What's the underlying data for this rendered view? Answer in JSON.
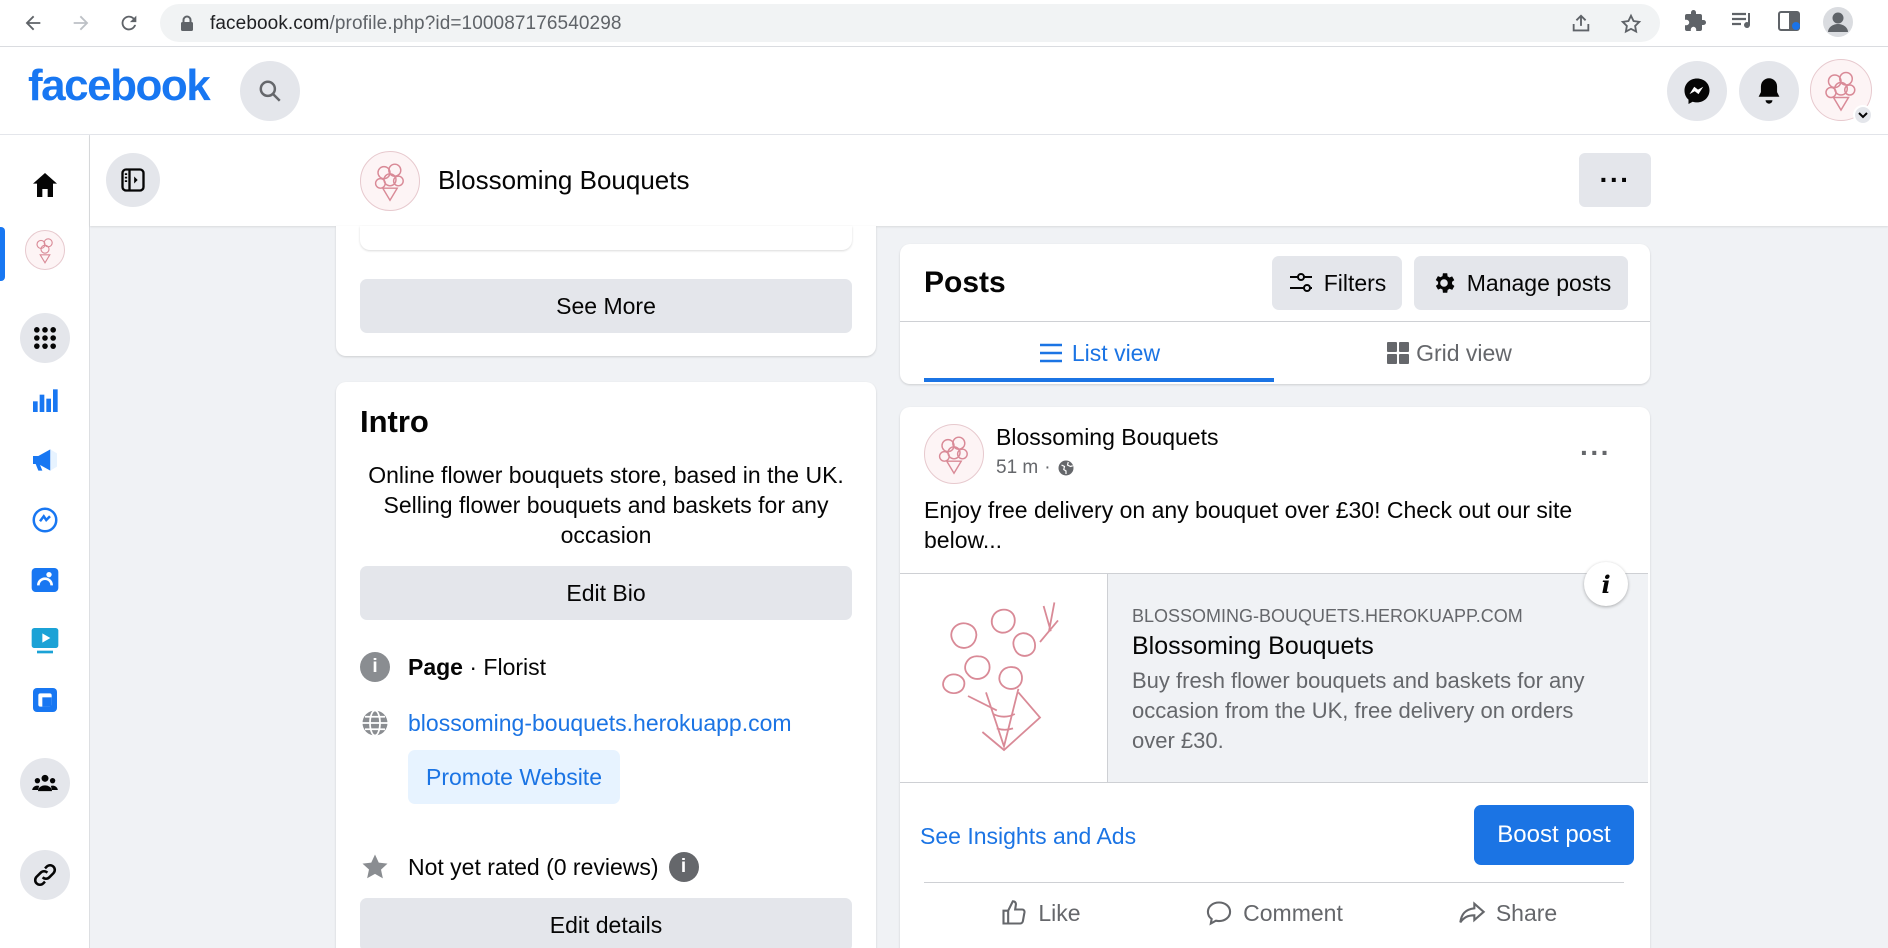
{
  "browser": {
    "url_host": "facebook.com",
    "url_path": "/profile.php?id=100087176540298"
  },
  "header": {
    "logo_text": "facebook"
  },
  "page": {
    "name": "Blossoming Bouquets"
  },
  "left_card": {
    "see_more_label": "See More"
  },
  "intro": {
    "title": "Intro",
    "bio": "Online flower bouquets store, based in the UK. Selling flower bouquets and baskets for any occasion",
    "edit_bio_label": "Edit Bio",
    "page_label": "Page",
    "category": " · Florist",
    "website": "blossoming-bouquets.herokuapp.com",
    "promote_label": "Promote Website",
    "rating_text": "Not yet rated (0 reviews)",
    "edit_details_label": "Edit details"
  },
  "posts": {
    "title": "Posts",
    "filters_label": "Filters",
    "manage_label": "Manage posts",
    "tabs": [
      {
        "label": "List view",
        "active": true
      },
      {
        "label": "Grid view",
        "active": false
      }
    ]
  },
  "post": {
    "author": "Blossoming Bouquets",
    "time": "51 m",
    "separator": "·",
    "text": "Enjoy free delivery on any bouquet over £30! Check out our site below...",
    "link": {
      "domain": "BLOSSOMING-BOUQUETS.HEROKUAPP.COM",
      "title": "Blossoming Bouquets",
      "description": "Buy fresh flower bouquets and baskets for any occasion from the UK, free delivery on orders over £30.",
      "info_glyph": "i"
    },
    "insights_label": "See Insights and Ads",
    "boost_label": "Boost post",
    "actions": {
      "like": "Like",
      "comment": "Comment",
      "share": "Share"
    }
  },
  "colors": {
    "brand": "#1877f2",
    "link": "#1b74e4",
    "background": "#f0f2f5",
    "button_gray": "#e4e6eb"
  }
}
